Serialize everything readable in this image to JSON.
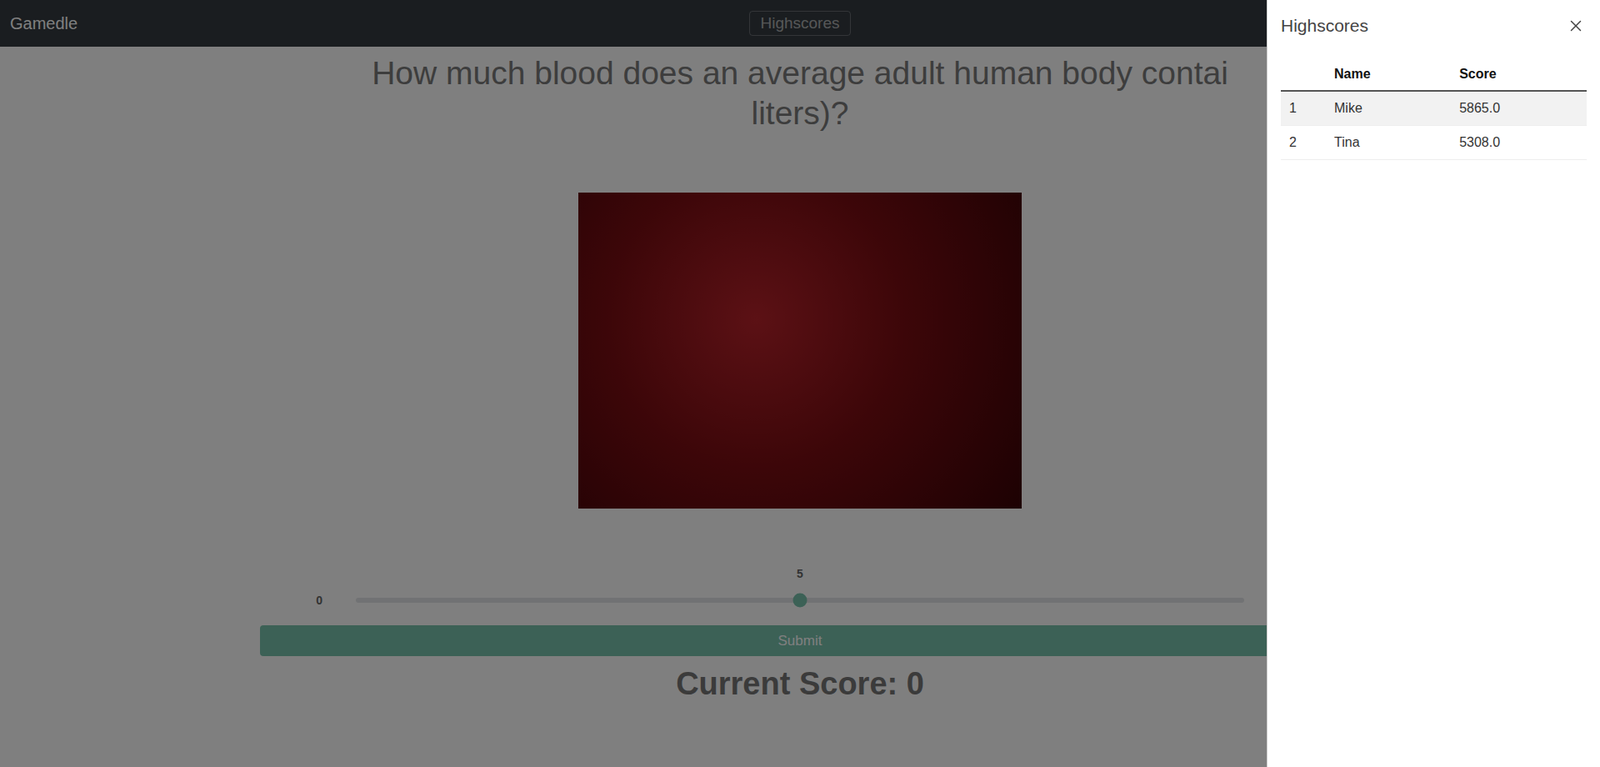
{
  "navbar": {
    "brand": "Gamedle",
    "button": "Highscores"
  },
  "question": {
    "lines": [
      "How much blood does an average adult human body contai",
      "liters)?"
    ]
  },
  "slider": {
    "min": "0",
    "value": "5",
    "level": 0.5
  },
  "submit": "Submit",
  "score": "Current Score: 0",
  "highscores": {
    "title": "Highscores",
    "columns": [
      "Name",
      "Score"
    ],
    "rows": [
      {
        "rank": "1",
        "name": "Mike",
        "score": "5865.0",
        "striped": true
      },
      {
        "rank": "2",
        "name": "Tina",
        "score": "5308.0",
        "striped": false
      }
    ]
  }
}
